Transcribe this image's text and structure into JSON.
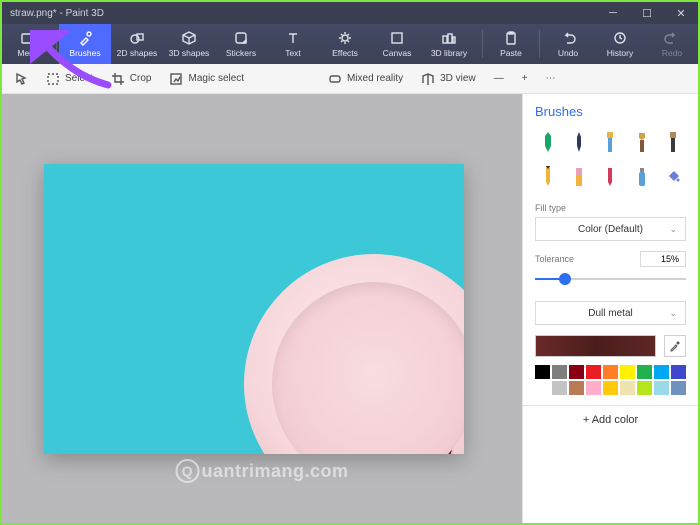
{
  "window": {
    "title": "straw.png* - Paint 3D"
  },
  "ribbon": {
    "menu": "Menu",
    "brushes": "Brushes",
    "shapes2d": "2D shapes",
    "shapes3d": "3D shapes",
    "stickers": "Stickers",
    "text": "Text",
    "effects": "Effects",
    "canvas": "Canvas",
    "library": "3D library",
    "paste": "Paste",
    "undo": "Undo",
    "history": "History",
    "redo": "Redo"
  },
  "toolbar": {
    "select": "Select",
    "crop": "Crop",
    "magic": "Magic select",
    "mixed": "Mixed reality",
    "view3d": "3D view"
  },
  "side": {
    "title": "Brushes",
    "fill_label": "Fill type",
    "fill_value": "Color (Default)",
    "tolerance_label": "Tolerance",
    "tolerance_value": "15%",
    "material_value": "Dull metal",
    "add_color": "+  Add color"
  },
  "palette_colors": [
    "#000000",
    "#7f7f7f",
    "#870014",
    "#ec1c23",
    "#ff7e26",
    "#fef200",
    "#22b14c",
    "#00a8f3",
    "#3f48cc",
    "#ffffff",
    "#c3c3c3",
    "#b97a56",
    "#ffadc8",
    "#ffc90d",
    "#efe4af",
    "#b5e61d",
    "#99d9ea",
    "#7092be"
  ],
  "watermark": "uantrimang.com"
}
